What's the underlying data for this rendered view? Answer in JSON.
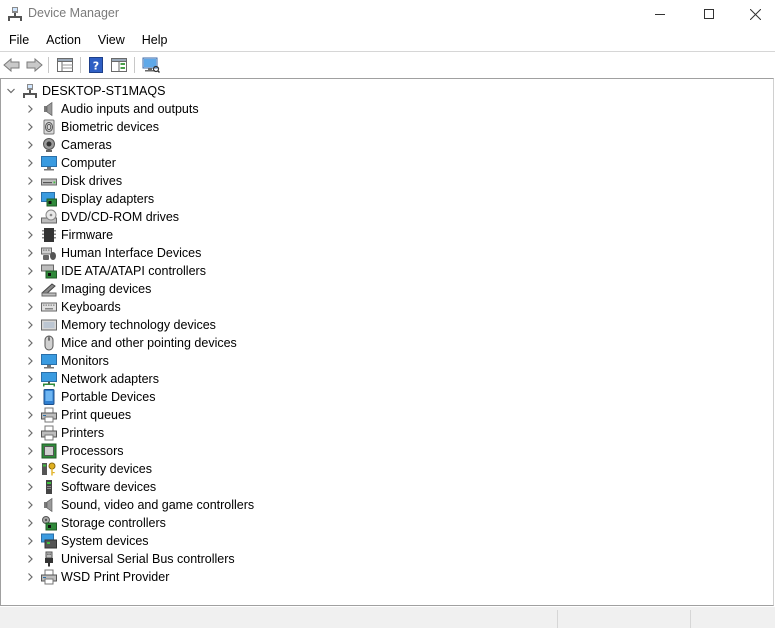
{
  "window": {
    "title": "Device Manager",
    "icons": {
      "app": "device-manager-icon",
      "minimize": "minimize-icon",
      "maximize": "maximize-icon",
      "close": "close-icon"
    }
  },
  "menu": [
    {
      "label": "File"
    },
    {
      "label": "Action"
    },
    {
      "label": "View"
    },
    {
      "label": "Help"
    }
  ],
  "toolbar": [
    {
      "icon": "back-arrow-icon"
    },
    {
      "icon": "forward-arrow-icon"
    },
    {
      "icon": "properties-grid-icon"
    },
    {
      "icon": "help-icon"
    },
    {
      "icon": "action-pane-icon"
    },
    {
      "icon": "scan-hardware-icon"
    }
  ],
  "tree": {
    "root": {
      "label": "DESKTOP-ST1MAQS",
      "icon": "computer-network-icon",
      "expanded": true
    },
    "items": [
      {
        "label": "Audio inputs and outputs",
        "icon": "speaker-icon"
      },
      {
        "label": "Biometric devices",
        "icon": "fingerprint-icon"
      },
      {
        "label": "Cameras",
        "icon": "camera-icon"
      },
      {
        "label": "Computer",
        "icon": "monitor-icon"
      },
      {
        "label": "Disk drives",
        "icon": "disk-drive-icon"
      },
      {
        "label": "Display adapters",
        "icon": "display-adapter-icon"
      },
      {
        "label": "DVD/CD-ROM drives",
        "icon": "dvd-drive-icon"
      },
      {
        "label": "Firmware",
        "icon": "firmware-chip-icon"
      },
      {
        "label": "Human Interface Devices",
        "icon": "hid-icon"
      },
      {
        "label": "IDE ATA/ATAPI controllers",
        "icon": "ide-controller-icon"
      },
      {
        "label": "Imaging devices",
        "icon": "imaging-device-icon"
      },
      {
        "label": "Keyboards",
        "icon": "keyboard-icon"
      },
      {
        "label": "Memory technology devices",
        "icon": "memory-card-icon"
      },
      {
        "label": "Mice and other pointing devices",
        "icon": "mouse-icon"
      },
      {
        "label": "Monitors",
        "icon": "monitor-icon"
      },
      {
        "label": "Network adapters",
        "icon": "network-adapter-icon"
      },
      {
        "label": "Portable Devices",
        "icon": "portable-device-icon"
      },
      {
        "label": "Print queues",
        "icon": "printer-icon"
      },
      {
        "label": "Printers",
        "icon": "printer-icon"
      },
      {
        "label": "Processors",
        "icon": "processor-icon"
      },
      {
        "label": "Security devices",
        "icon": "security-key-icon"
      },
      {
        "label": "Software devices",
        "icon": "software-device-icon"
      },
      {
        "label": "Sound, video and game controllers",
        "icon": "speaker-icon"
      },
      {
        "label": "Storage controllers",
        "icon": "storage-controller-icon"
      },
      {
        "label": "System devices",
        "icon": "system-devices-icon"
      },
      {
        "label": "Universal Serial Bus controllers",
        "icon": "usb-icon"
      },
      {
        "label": "WSD Print Provider",
        "icon": "printer-icon"
      }
    ]
  },
  "colors": {
    "accent": "#1e88e5",
    "chevron": "#6b6b6b",
    "border": "#a0a0a0"
  }
}
